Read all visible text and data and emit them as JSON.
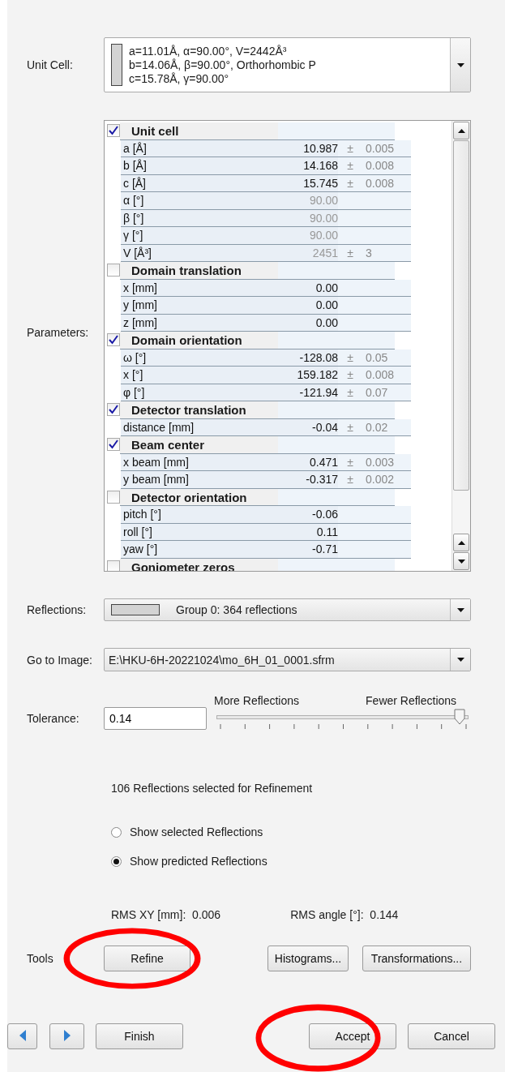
{
  "unit_cell": {
    "label": "Unit Cell:",
    "lines": [
      "a=11.01Å,  α=90.00°,  V=2442Å³",
      "b=14.06Å,  β=90.00°,  Orthorhombic P",
      "c=15.78Å,  γ=90.00°"
    ]
  },
  "parameters": {
    "label": "Parameters:",
    "groups": [
      {
        "title": "Unit cell",
        "checked": true,
        "items": [
          {
            "label": "a [Å]",
            "value": "10.987",
            "pm": "±",
            "error": "0.005",
            "fixed": false
          },
          {
            "label": "b [Å]",
            "value": "14.168",
            "pm": "±",
            "error": "0.008",
            "fixed": false
          },
          {
            "label": "c [Å]",
            "value": "15.745",
            "pm": "±",
            "error": "0.008",
            "fixed": false
          },
          {
            "label": "α [°]",
            "value": "90.00",
            "fixed": true
          },
          {
            "label": "β [°]",
            "value": "90.00",
            "fixed": true
          },
          {
            "label": "γ [°]",
            "value": "90.00",
            "fixed": true
          },
          {
            "label": "V [Å³]",
            "value": "2451",
            "pm": "±",
            "error": "3",
            "fixed": true
          }
        ]
      },
      {
        "title": "Domain translation",
        "checked": false,
        "items": [
          {
            "label": "x [mm]",
            "value": "0.00",
            "fixed": false
          },
          {
            "label": "y [mm]",
            "value": "0.00",
            "fixed": false
          },
          {
            "label": "z [mm]",
            "value": "0.00",
            "fixed": false
          }
        ]
      },
      {
        "title": "Domain orientation",
        "checked": true,
        "items": [
          {
            "label": "ω [°]",
            "value": "-128.08",
            "pm": "±",
            "error": "0.05",
            "fixed": false
          },
          {
            "label": "x [°]",
            "value": "159.182",
            "pm": "±",
            "error": "0.008",
            "fixed": false
          },
          {
            "label": "φ [°]",
            "value": "-121.94",
            "pm": "±",
            "error": "0.07",
            "fixed": false
          }
        ]
      },
      {
        "title": "Detector translation",
        "checked": true,
        "items": [
          {
            "label": "distance [mm]",
            "value": "-0.04",
            "pm": "±",
            "error": "0.02",
            "fixed": false
          }
        ]
      },
      {
        "title": "Beam center",
        "checked": true,
        "items": [
          {
            "label": "x beam [mm]",
            "value": "0.471",
            "pm": "±",
            "error": "0.003",
            "fixed": false
          },
          {
            "label": "y beam [mm]",
            "value": "-0.317",
            "pm": "±",
            "error": "0.002",
            "fixed": false
          }
        ]
      },
      {
        "title": "Detector orientation",
        "checked": false,
        "items": [
          {
            "label": "pitch [°]",
            "value": "-0.06",
            "fixed": false
          },
          {
            "label": "roll [°]",
            "value": "0.11",
            "fixed": false
          },
          {
            "label": "yaw [°]",
            "value": "-0.71",
            "fixed": false
          }
        ]
      },
      {
        "title": "Goniometer zeros",
        "checked": false
      }
    ]
  },
  "reflections": {
    "label": "Reflections:",
    "value": "Group 0: 364 reflections"
  },
  "go_to_image": {
    "label": "Go to Image:",
    "value": "E:\\HKU-6H-20221024\\mo_6H_01_0001.sfrm"
  },
  "tolerance": {
    "label": "Tolerance:",
    "value": "0.14",
    "left_label": "More Reflections",
    "right_label": "Fewer Reflections",
    "level": 0.96
  },
  "selected_count": "106  Reflections selected for Refinement",
  "display": [
    {
      "label": "Show selected Reflections",
      "selected": false
    },
    {
      "label": "Show predicted Reflections",
      "selected": true
    }
  ],
  "rms": [
    {
      "label": "RMS XY [mm]:",
      "value": "0.006"
    },
    {
      "label": "RMS angle [°]:",
      "value": "0.144"
    }
  ],
  "tools": {
    "label": "Tools",
    "buttons": [
      {
        "label": "Refine",
        "highlighted": true
      },
      {
        "label": "Histograms...",
        "highlighted": false
      },
      {
        "label": "Transformations...",
        "highlighted": false
      }
    ]
  },
  "footer": {
    "buttons": [
      {
        "label": "Finish",
        "highlighted": false
      },
      {
        "label": "Accept",
        "highlighted": true
      },
      {
        "label": "Cancel",
        "highlighted": false
      }
    ]
  }
}
